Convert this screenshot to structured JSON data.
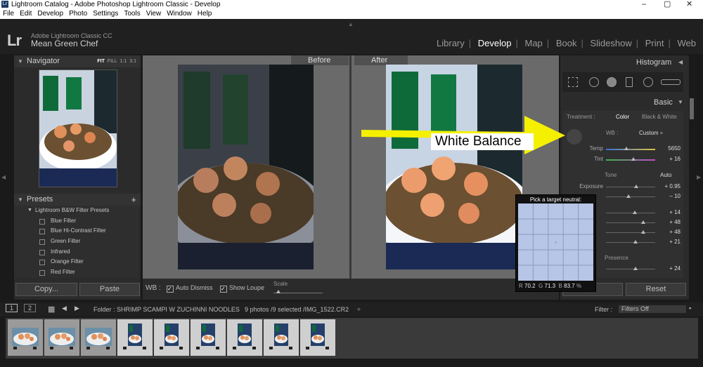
{
  "window": {
    "title": "Lightroom Catalog - Adobe Photoshop Lightroom Classic - Develop",
    "app_icon": "Lr",
    "controls": [
      "–",
      "▢",
      "✕"
    ]
  },
  "menu": [
    "File",
    "Edit",
    "Develop",
    "Photo",
    "Settings",
    "Tools",
    "View",
    "Window",
    "Help"
  ],
  "header": {
    "logo": "Lr",
    "product": "Adobe Lightroom Classic CC",
    "catalog": "Mean Green Chef",
    "modules": [
      "Library",
      "Develop",
      "Map",
      "Book",
      "Slideshow",
      "Print",
      "Web"
    ],
    "active_module": "Develop"
  },
  "navigator": {
    "title": "Navigator",
    "zoom": [
      "FIT",
      "FILL",
      "1:1",
      "3:1"
    ]
  },
  "presets": {
    "title": "Presets",
    "add_symbol": "+",
    "group": "Lightroom B&W Filter Presets",
    "items": [
      "Blue Filter",
      "Blue Hi-Contrast Filter",
      "Green Filter",
      "Infrared",
      "Orange Filter",
      "Red Filter"
    ],
    "copy_button": "Copy...",
    "paste_button": "Paste"
  },
  "view": {
    "before_label": "Before",
    "after_label": "After"
  },
  "toolbar": {
    "wb_label": "WB :",
    "auto_dismiss": "Auto Dismiss",
    "show_loupe": "Show Loupe",
    "scale": "Scale"
  },
  "right_panel": {
    "histogram_title": "Histogram",
    "basic_title": "Basic",
    "treatment_label": "Treatment :",
    "treatment_color": "Color",
    "treatment_bw": "Black & White",
    "wb_label": "WB :",
    "wb_value": "Custom ÷",
    "sliders_top": [
      {
        "label": "Temp",
        "value": "5650",
        "level": 0.42
      },
      {
        "label": "Tint",
        "value": "+ 16",
        "level": 0.55
      }
    ],
    "tone_title": "Tone",
    "tone_auto": "Auto",
    "tone_sliders": [
      {
        "label": "Exposure",
        "value": "+ 0.95",
        "level": 0.62
      },
      {
        "label": "",
        "value": "– 10",
        "level": 0.45
      },
      {
        "label": "",
        "value": "+ 14",
        "level": 0.58
      },
      {
        "label": "",
        "value": "+ 48",
        "level": 0.75
      },
      {
        "label": "",
        "value": "+ 48",
        "level": 0.75
      },
      {
        "label": "",
        "value": "+ 21",
        "level": 0.6
      }
    ],
    "presence_title": "Presence",
    "presence_sliders": [
      {
        "label": "",
        "value": "+ 24",
        "level": 0.6
      }
    ],
    "prev_button_partial": "...",
    "reset_button": "Reset"
  },
  "filmstrip_bar": {
    "page1": "1",
    "page2": "2",
    "folder": "Folder : SHRIMP SCAMPI W ZUCHINNI NOODLES",
    "count": "9 photos /9 selected /IMG_1522.CR2",
    "count_suffix": "÷",
    "filter_label": "Filter :",
    "filter_value": "Filters Off"
  },
  "filmstrip": {
    "thumb_count": 9,
    "selected_from": 4
  },
  "annotation": {
    "label": "White Balance",
    "arrow_color": "#f4f000"
  },
  "picker": {
    "title": "Pick a target neutral:",
    "r_label": "R",
    "r": "70.2",
    "g_label": "G",
    "g": "71.3",
    "b_label": "B",
    "b": "83.7",
    "unit": "%",
    "color": "#b7c5e6"
  }
}
